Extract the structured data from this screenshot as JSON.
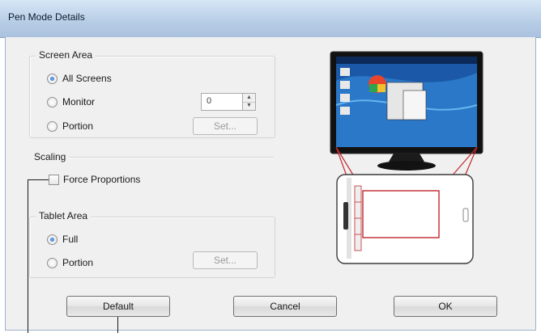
{
  "window": {
    "title": "Pen Mode Details"
  },
  "screen_area": {
    "legend": "Screen Area",
    "options": [
      {
        "label": "All Screens",
        "selected": true
      },
      {
        "label": "Monitor",
        "selected": false
      },
      {
        "label": "Portion",
        "selected": false
      }
    ],
    "monitor_value": "0",
    "set_label": "Set..."
  },
  "scaling": {
    "legend": "Scaling",
    "force_proportions_label": "Force Proportions",
    "force_proportions_checked": false
  },
  "tablet_area": {
    "legend": "Tablet Area",
    "options": [
      {
        "label": "Full",
        "selected": true
      },
      {
        "label": "Portion",
        "selected": false
      }
    ],
    "set_label": "Set..."
  },
  "buttons": {
    "default_label": "Default",
    "cancel_label": "Cancel",
    "ok_label": "OK"
  },
  "icons": {
    "spin_up": "spin-up-icon",
    "spin_down": "spin-down-icon",
    "monitor": "monitor-illustration",
    "tablet": "tablet-illustration"
  },
  "colors": {
    "title_bar": "#b7cde6",
    "mapping_lines": "#c0282d",
    "dialog_bg": "#f0f0f0"
  }
}
